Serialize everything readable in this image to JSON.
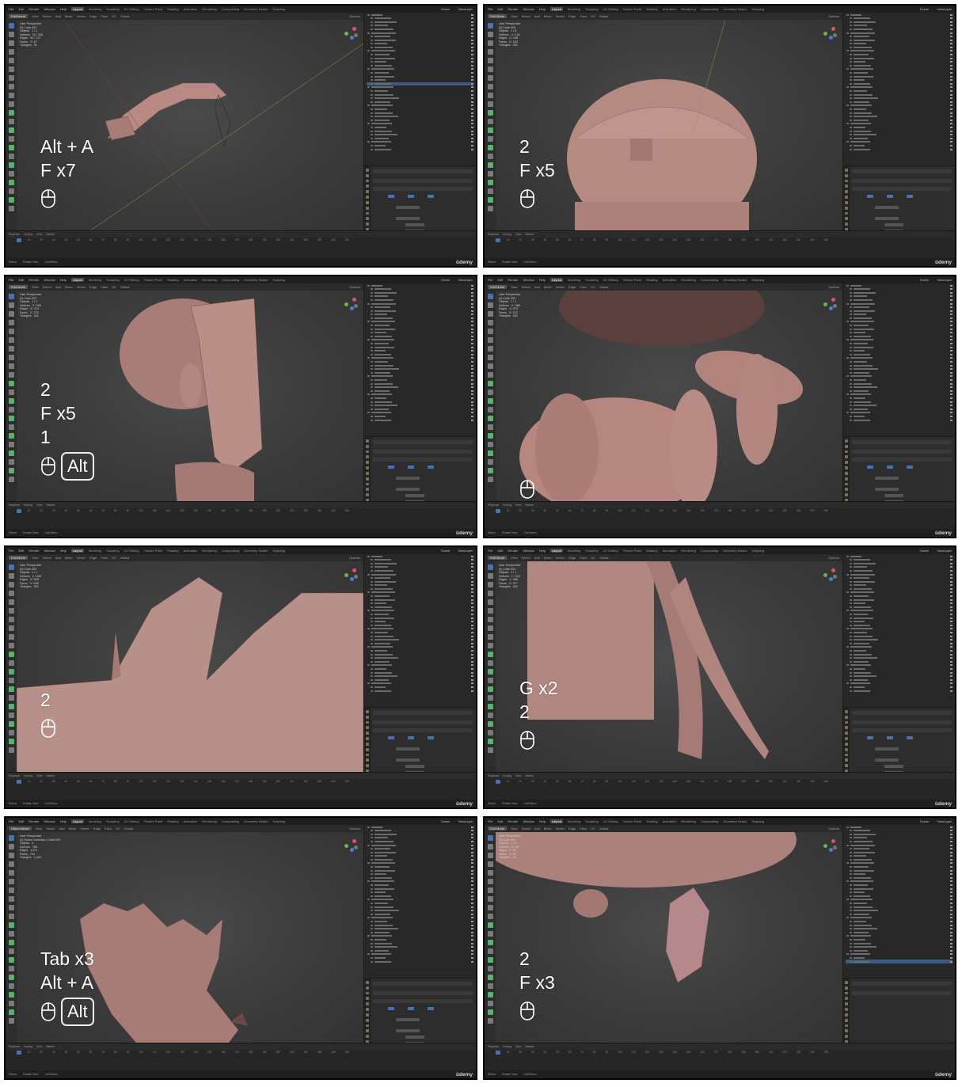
{
  "common": {
    "menus": [
      "File",
      "Edit",
      "Render",
      "Window",
      "Help"
    ],
    "workspaces": [
      "Layout",
      "Modeling",
      "Sculpting",
      "UV Editing",
      "Texture Paint",
      "Shading",
      "Animation",
      "Rendering",
      "Compositing",
      "Geometry Nodes",
      "Scripting"
    ],
    "active_workspace": "Layout",
    "scene_label": "Scene",
    "viewlayer_label": "ViewLayer",
    "header_items": [
      "View",
      "Select",
      "Add",
      "Mesh",
      "Vertex",
      "Edge",
      "Face",
      "UV"
    ],
    "edit_mode": "Edit Mode",
    "object_mode": "Object Mode",
    "global_label": "Global",
    "options_label": "Options",
    "timeline_items": [
      "Playback",
      "Keying",
      "View",
      "Marker"
    ],
    "ruler_ticks": [
      "0",
      "10",
      "20",
      "30",
      "40",
      "50",
      "60",
      "70",
      "80",
      "90",
      "100",
      "110",
      "120",
      "130",
      "140",
      "150",
      "160",
      "170",
      "180",
      "190",
      "200",
      "210",
      "220",
      "230",
      "240",
      "250"
    ],
    "status_select": "Select",
    "status_rotate": "Rotate View",
    "status_call_menu": "Call Menu",
    "watermark": "ûdemy",
    "viewport_title": "User Perspective",
    "modifier_label": "Mirror"
  },
  "panels": [
    {
      "id": "p1",
      "collection_line": "(0) Cube.003",
      "stats": [
        "Objects   1 / 1",
        "Vertices   32 / 336",
        "Edges   53 / 172",
        "Faces   3 / 17",
        "Triangles   34"
      ],
      "overlay_lines": [
        "Alt + A",
        "F x7"
      ],
      "mouse_icon": true,
      "alt_badge": ""
    },
    {
      "id": "p2",
      "collection_line": "(0) Cube.003",
      "stats": [
        "Objects   1 / 8",
        "Vertices   3 / 144",
        "Edges   3 / 158",
        "Faces   0 / 153",
        "Triangles   263"
      ],
      "overlay_lines": [
        "2",
        "F x5"
      ],
      "mouse_icon": true,
      "alt_badge": ""
    },
    {
      "id": "p3",
      "collection_line": "(0) Cube.003",
      "stats": [
        "Objects   1 / 1",
        "Vertices   3 / 336",
        "Edges   3 / 479",
        "Faces   0 / 223",
        "Triangles   444"
      ],
      "overlay_lines": [
        "2",
        "F x5",
        "1"
      ],
      "mouse_icon": true,
      "alt_badge": "Alt"
    },
    {
      "id": "p4",
      "collection_line": "(0) Cube.003",
      "stats": [
        "Objects   1 / 1",
        "Vertices   3 / 388",
        "Edges   3 / 573",
        "Faces   0 / 223",
        "Triangles   536"
      ],
      "overlay_lines": [],
      "mouse_icon": true,
      "alt_badge": ""
    },
    {
      "id": "p5",
      "collection_line": "(0) Cube.003",
      "stats": [
        "Objects   1 / 1",
        "Vertices   0 / 428",
        "Edges   0 / 628",
        "Faces   0 / 608",
        "Triangles   560"
      ],
      "overlay_lines": [
        "2"
      ],
      "mouse_icon": true,
      "alt_badge": ""
    },
    {
      "id": "p6",
      "collection_line": "(0) Cube.003",
      "stats": [
        "Objects   1 / 1",
        "Vertices   1 / 344",
        "Edges   1 / 465",
        "Faces   0 / 377",
        "Triangles   424"
      ],
      "overlay_lines": [
        "G x2",
        "2"
      ],
      "mouse_icon": true,
      "alt_badge": ""
    },
    {
      "id": "p7",
      "collection_line": "(0) Scene Collection | Cube.003",
      "stats": [
        "Objects   3",
        "Vertices   758",
        "Edges   1,471",
        "Faces   734",
        "Triangles   1,429"
      ],
      "overlay_lines": [
        "Tab x3",
        "Alt + A"
      ],
      "mouse_icon": true,
      "alt_badge": "Alt"
    },
    {
      "id": "p8",
      "collection_line": "(0) Cube.003",
      "stats": [
        "Objects   1 / 9",
        "Vertices   3 / 38",
        "Edges   3 / 58",
        "Faces   0 / 22",
        "Triangles   40"
      ],
      "overlay_lines": [
        "2",
        "F x3"
      ],
      "mouse_icon": true,
      "alt_badge": ""
    }
  ]
}
